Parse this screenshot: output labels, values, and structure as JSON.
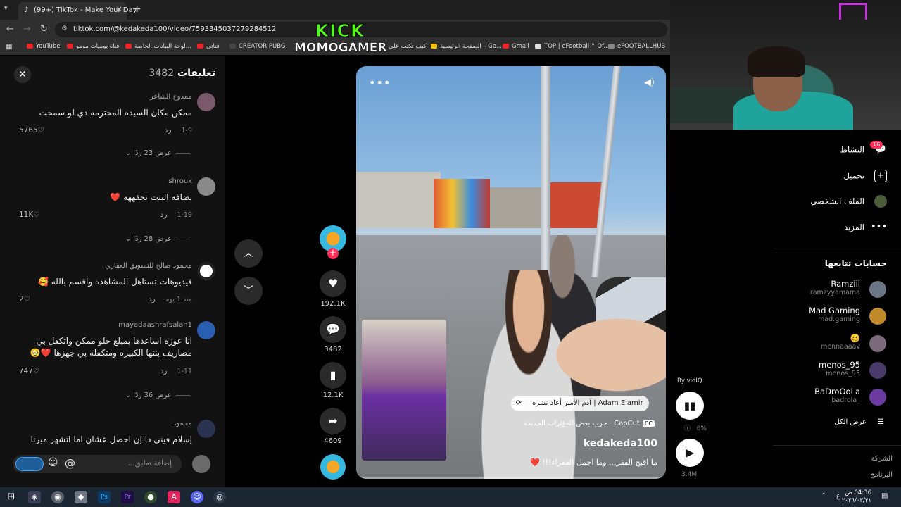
{
  "browser": {
    "tab_title": "(99+) TikTok - Make Your Day",
    "url": "tiktok.com/@kedakeda100/video/7593345037279284512",
    "bookmarks": [
      "YouTube",
      "قناة يوميات مومو",
      "لوحة البيانات الخاصة...",
      "قناتي",
      "CREATOR PUBG",
      "كيف تكتب علي",
      "الصفحة الرئيسية – Go...",
      "Gmail",
      "TOP | eFootball™ Of...",
      "eFOOTBALLHUB"
    ]
  },
  "overlay": {
    "line1": "KICK",
    "line2": "MOMOGAMER"
  },
  "comments": {
    "title": "تعليقات",
    "count": "3482",
    "items": [
      {
        "user": "ممدوح الشاعر",
        "text": "ممكن مكان السيده المحترمه دي لو سمحت",
        "date": "1-9",
        "reply": "رد",
        "likes": "5765",
        "replies": "عرض 23 ردًا"
      },
      {
        "user": "shrouk",
        "text": "نضافه البنت تحفههه ❤️",
        "date": "1-19",
        "reply": "رد",
        "likes": "11K",
        "replies": "عرض 28 ردًا"
      },
      {
        "user": "محمود صالح للتسويق العقاري",
        "text": "فيديوهات تستاهل المشاهده واقسم بالله 🥰",
        "date": "منذ 1 يوم",
        "reply": "رد",
        "likes": "2",
        "replies": ""
      },
      {
        "user": "mayadaashrafsalah1",
        "text": "انا عوزه اساعدها بمبلغ حلو ممكن واتكفل بي مصاريف بنتها الكبيره ومتكفله بي جهزها ❤️🥹",
        "date": "1-11",
        "reply": "رد",
        "likes": "747",
        "replies": "عرض 36 ردًا"
      },
      {
        "user": "محمود",
        "text": "إسلام فيني دا إن احصل عشان اما اتشهر ميرنا",
        "date": "",
        "reply": "",
        "likes": "",
        "replies": ""
      }
    ],
    "input_placeholder": "إضافة تعليق..."
  },
  "video": {
    "author": "kedakeda100",
    "caption": "ما اقبح الفقر... وما اجمل الفقراء!!! ❤️",
    "repost_label": "Adam Elamir | آدم الأمير أعاد نشره",
    "effect_label": "CapCut · جرب بعض المؤثرات الجديدة"
  },
  "actions": {
    "likes": "192.1K",
    "comments": "3482",
    "saves": "12.1K",
    "shares": "4609"
  },
  "sidebar": {
    "nav": [
      {
        "label": "النشاط",
        "icon": "activity-icon",
        "badge": "16"
      },
      {
        "label": "تحميل",
        "icon": "upload-icon"
      },
      {
        "label": "الملف الشخصي",
        "icon": "profile-icon"
      },
      {
        "label": "المزيد",
        "icon": "more-icon"
      }
    ],
    "following_title": "حسابات تتابعها",
    "accounts": [
      {
        "name": "Ramziii",
        "handle": "ramzyyamama"
      },
      {
        "name": "Mad Gaming",
        "handle": "mad.gaming"
      },
      {
        "name": "🥴",
        "handle": "mennaaaav"
      },
      {
        "name": "menos_95",
        "handle": "menos_95"
      },
      {
        "name": "BaDroOoLa",
        "handle": "badrola_"
      }
    ],
    "see_all": "عرض الكل",
    "footer": [
      "الشركة",
      "البرنامج"
    ]
  },
  "vidiq": {
    "label": "By vidIQ",
    "percent": "6%",
    "views": "3.4M"
  },
  "taskbar": {
    "time": "04:36 ص",
    "date": "٢٠٢٦/٠٣/٢١",
    "lang": "ع"
  }
}
